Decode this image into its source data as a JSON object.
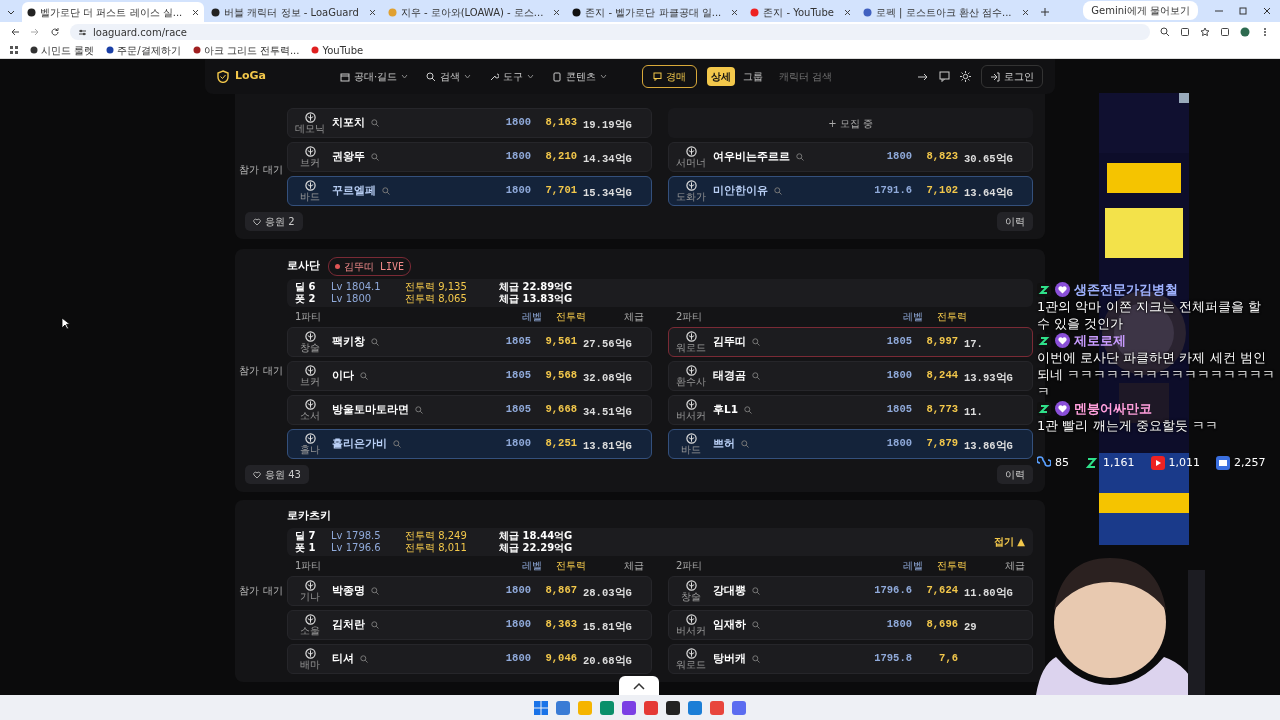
{
  "browser": {
    "tabs": [
      {
        "title": "벨가로단 더 퍼스트 레이스 실...",
        "selected": true
      },
      {
        "title": "버블 캐릭터 정보 - LoaGuard",
        "selected": false
      },
      {
        "title": "지우 - 로아와(LOAWA) - 로스...",
        "selected": false
      },
      {
        "title": "존지 - 벨가로단 파클공대 일...",
        "selected": false
      },
      {
        "title": "존지 - YouTube",
        "selected": false
      },
      {
        "title": "로펙 | 로스트아크 환산 점수...",
        "selected": false
      }
    ],
    "url": "loaguard.com/race",
    "bookmarks": [
      "시민드 룰렛",
      "주문/결제하기",
      "아크 그리드 전투력...",
      "YouTube"
    ],
    "assistant_button": "Gemini에게 물어보기"
  },
  "nav": {
    "logo": "LoGa",
    "menus": [
      "공대·길드",
      "검색",
      "도구",
      "콘텐츠"
    ],
    "auction": "경매",
    "view_toggle": [
      {
        "label": "상세",
        "selected": true
      },
      {
        "label": "그룹",
        "selected": false
      }
    ],
    "search_placeholder": "캐릭터 검색",
    "login": "로그인"
  },
  "raids": [
    {
      "side_label": "참가 대기",
      "parties": [
        {
          "members": [
            {
              "kind": "member",
              "class": "데모닉",
              "name": "치포치",
              "level": "1800",
              "power": "8,163",
              "tier": "19.19억G",
              "highlighted": false,
              "live": false
            },
            {
              "kind": "member",
              "class": "브커",
              "name": "권왕뚜",
              "level": "1800",
              "power": "8,210",
              "tier": "14.34억G",
              "highlighted": false,
              "live": false
            },
            {
              "kind": "member",
              "class": "바드",
              "name": "꾸르엘페",
              "level": "1800",
              "power": "7,701",
              "tier": "15.34억G",
              "highlighted": true,
              "live": false
            }
          ]
        },
        {
          "members": [
            {
              "kind": "recruiting",
              "label": "+ 모집 중"
            },
            {
              "kind": "member",
              "class": "서머너",
              "name": "여우비는주르르",
              "level": "1800",
              "power": "8,823",
              "tier": "30.65억G",
              "highlighted": false,
              "live": false
            },
            {
              "kind": "member",
              "class": "도화가",
              "name": "미안한이유",
              "level": "1791.6",
              "power": "7,102",
              "tier": "13.64억G",
              "highlighted": true,
              "live": false
            }
          ]
        }
      ],
      "cheer": "응원 2",
      "history": "이력"
    },
    {
      "title": "로사단",
      "live_badge": "김뚜띠 LIVE",
      "side_label": "참가 대기",
      "summary": [
        {
          "role": "딜 6",
          "level": "Lv 1804.1",
          "power": "전투력 9,135",
          "tier": "체급 22.89억G"
        },
        {
          "role": "폿 2",
          "level": "Lv 1800",
          "power": "전투력 8,065",
          "tier": "체급 13.83억G"
        }
      ],
      "parties": [
        {
          "label": "1파티",
          "columns": [
            "레벨",
            "전투력",
            "체급"
          ],
          "members": [
            {
              "kind": "member",
              "class": "창술",
              "name": "팩키창",
              "level": "1805",
              "power": "9,561",
              "tier": "27.56억G",
              "highlighted": false,
              "live": false
            },
            {
              "kind": "member",
              "class": "브커",
              "name": "이다",
              "level": "1805",
              "power": "9,568",
              "tier": "32.08억G",
              "highlighted": false,
              "live": false
            },
            {
              "kind": "member",
              "class": "소서",
              "name": "방울토마토라면",
              "level": "1805",
              "power": "9,668",
              "tier": "34.51억G",
              "highlighted": false,
              "live": false
            },
            {
              "kind": "member",
              "class": "홀나",
              "name": "홀리은가비",
              "level": "1800",
              "power": "8,251",
              "tier": "13.81억G",
              "highlighted": true,
              "live": false
            }
          ]
        },
        {
          "label": "2파티",
          "columns": [
            "레벨",
            "전투력"
          ],
          "members": [
            {
              "kind": "member",
              "class": "워로드",
              "name": "김뚜띠",
              "level": "1805",
              "power": "8,997",
              "tier": "17.",
              "highlighted": false,
              "live": true
            },
            {
              "kind": "member",
              "class": "환수사",
              "name": "태경곰",
              "level": "1800",
              "power": "8,244",
              "tier": "13.93억G",
              "highlighted": false,
              "live": false
            },
            {
              "kind": "member",
              "class": "버서커",
              "name": "후L1",
              "level": "1805",
              "power": "8,773",
              "tier": "11.",
              "highlighted": false,
              "live": false
            },
            {
              "kind": "member",
              "class": "바드",
              "name": "쁘허",
              "level": "1800",
              "power": "7,879",
              "tier": "13.86억G",
              "highlighted": true,
              "live": false
            }
          ]
        }
      ],
      "cheer": "응원 43",
      "history": "이력"
    },
    {
      "title": "로카츠키",
      "side_label": "참가 대기",
      "summary": [
        {
          "role": "딜 7",
          "level": "Lv 1798.5",
          "power": "전투력 8,249",
          "tier": "체급 18.44억G"
        },
        {
          "role": "폿 1",
          "level": "Lv 1796.6",
          "power": "전투력 8,011",
          "tier": "체급 22.29억G"
        }
      ],
      "collapse": "접기 ▲",
      "parties": [
        {
          "label": "1파티",
          "columns": [
            "레벨",
            "전투력",
            "체급"
          ],
          "members": [
            {
              "kind": "member",
              "class": "기나",
              "name": "박종명",
              "level": "1800",
              "power": "8,867",
              "tier": "28.03억G",
              "highlighted": false,
              "live": false
            },
            {
              "kind": "member",
              "class": "소울",
              "name": "김처란",
              "level": "1800",
              "power": "8,363",
              "tier": "15.81억G",
              "highlighted": false,
              "live": false
            },
            {
              "kind": "member",
              "class": "배마",
              "name": "티셔",
              "level": "1800",
              "power": "9,046",
              "tier": "20.68억G",
              "highlighted": false,
              "live": false
            }
          ]
        },
        {
          "label": "2파티",
          "columns": [
            "레벨",
            "전투력",
            "체급"
          ],
          "members": [
            {
              "kind": "member",
              "class": "창술",
              "name": "강대뿡",
              "level": "1796.6",
              "power": "7,624",
              "tier": "11.80억G",
              "highlighted": false,
              "live": false
            },
            {
              "kind": "member",
              "class": "버서커",
              "name": "임재하",
              "level": "1800",
              "power": "8,696",
              "tier": "29",
              "highlighted": false,
              "live": false
            },
            {
              "kind": "member",
              "class": "워로드",
              "name": "탕버캐",
              "level": "1795.8",
              "power": "7,6",
              "highlighted": false,
              "live": false
            }
          ]
        }
      ]
    }
  ],
  "chat": {
    "messages": [
      {
        "user": "생존전문가김병철",
        "color": "#9fb2ff",
        "text": "1관의 악마 이쫀 지크는 전체퍼클을 할 수 있을 것인가"
      },
      {
        "user": "제로로제",
        "color": "#c89bff",
        "text": "이번에 로사단 파클하면 카제 세컨 범인되네 ㅋㅋㅋㅋㅋㅋㅋㅋㅋㅋㅋㅋㅋㅋㅋㅋㅋ"
      },
      {
        "user": "멘붕어싸만코",
        "color": "#ff9fdc",
        "text": "1관 빨리 깨는게 중요할듯 ㅋㅋ"
      }
    ],
    "stats": [
      {
        "kind": "loop",
        "value": "85"
      },
      {
        "kind": "z",
        "value": "1,161"
      },
      {
        "kind": "play",
        "value": "1,011"
      },
      {
        "kind": "tv",
        "value": "2,257"
      }
    ]
  }
}
